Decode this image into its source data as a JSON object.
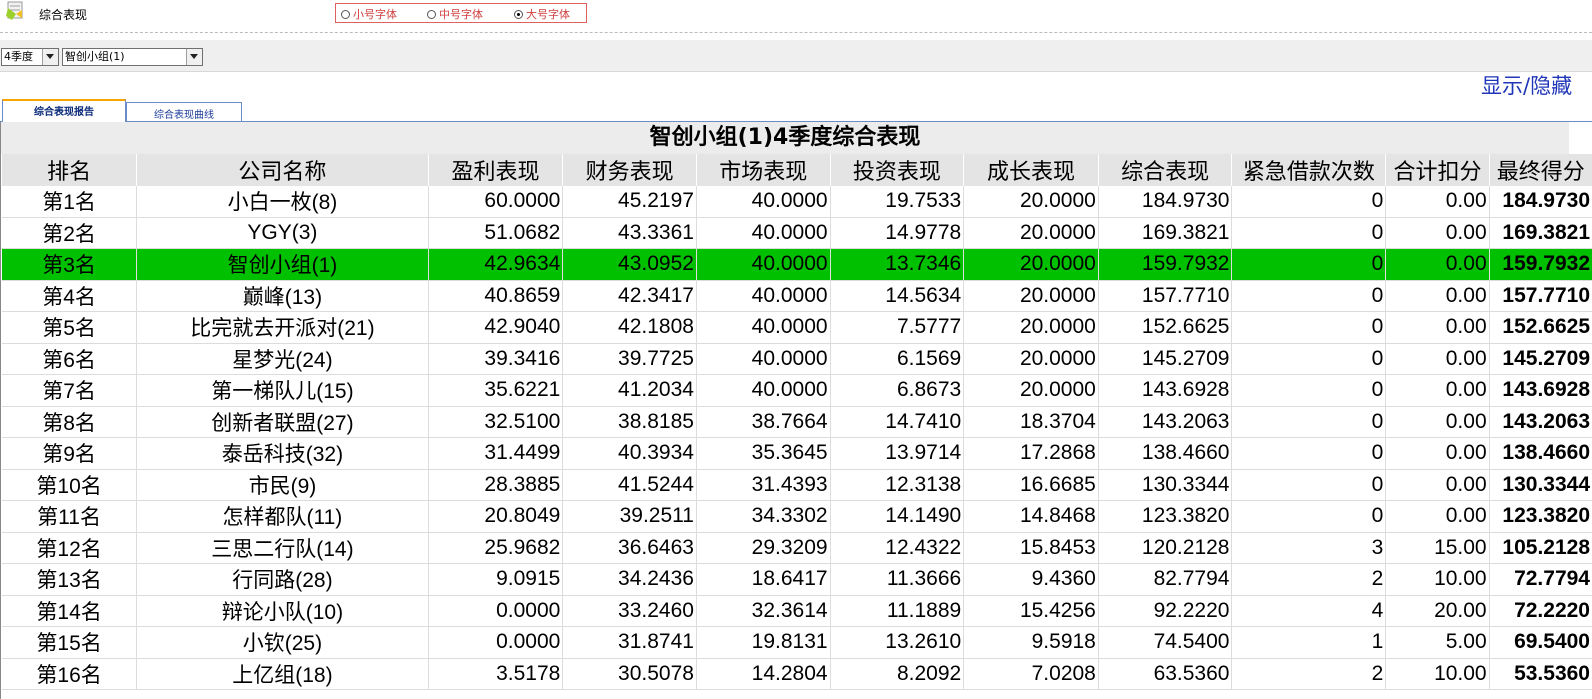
{
  "header": {
    "page_title": "综合表现",
    "font_size_options": [
      {
        "label": "小号字体",
        "checked": false
      },
      {
        "label": "中号字体",
        "checked": false
      },
      {
        "label": "大号字体",
        "checked": true
      }
    ]
  },
  "filters": {
    "quarter": "4季度",
    "group": "智创小组(1)"
  },
  "toggle_label": "显示/隐藏",
  "tabs": [
    {
      "label": "综合表现报告",
      "active": true
    },
    {
      "label": "综合表现曲线",
      "active": false
    }
  ],
  "report": {
    "title": "智创小组(1)4季度综合表现",
    "columns": [
      "排名",
      "公司名称",
      "盈利表现",
      "财务表现",
      "市场表现",
      "投资表现",
      "成长表现",
      "综合表现",
      "紧急借款次数",
      "合计扣分",
      "最终得分"
    ],
    "highlight_color": "#00c000",
    "rows": [
      {
        "rank": "第1名",
        "company": "小白一枚(8)",
        "profit": "60.0000",
        "finance": "45.2197",
        "market": "40.0000",
        "invest": "19.7533",
        "growth": "20.0000",
        "overall": "184.9730",
        "loans": "0",
        "deduct": "0.00",
        "final": "184.9730",
        "highlight": false
      },
      {
        "rank": "第2名",
        "company": "YGY(3)",
        "profit": "51.0682",
        "finance": "43.3361",
        "market": "40.0000",
        "invest": "14.9778",
        "growth": "20.0000",
        "overall": "169.3821",
        "loans": "0",
        "deduct": "0.00",
        "final": "169.3821",
        "highlight": false
      },
      {
        "rank": "第3名",
        "company": "智创小组(1)",
        "profit": "42.9634",
        "finance": "43.0952",
        "market": "40.0000",
        "invest": "13.7346",
        "growth": "20.0000",
        "overall": "159.7932",
        "loans": "0",
        "deduct": "0.00",
        "final": "159.7932",
        "highlight": true
      },
      {
        "rank": "第4名",
        "company": "巅峰(13)",
        "profit": "40.8659",
        "finance": "42.3417",
        "market": "40.0000",
        "invest": "14.5634",
        "growth": "20.0000",
        "overall": "157.7710",
        "loans": "0",
        "deduct": "0.00",
        "final": "157.7710",
        "highlight": false
      },
      {
        "rank": "第5名",
        "company": "比完就去开派对(21)",
        "profit": "42.9040",
        "finance": "42.1808",
        "market": "40.0000",
        "invest": "7.5777",
        "growth": "20.0000",
        "overall": "152.6625",
        "loans": "0",
        "deduct": "0.00",
        "final": "152.6625",
        "highlight": false
      },
      {
        "rank": "第6名",
        "company": "星梦光(24)",
        "profit": "39.3416",
        "finance": "39.7725",
        "market": "40.0000",
        "invest": "6.1569",
        "growth": "20.0000",
        "overall": "145.2709",
        "loans": "0",
        "deduct": "0.00",
        "final": "145.2709",
        "highlight": false
      },
      {
        "rank": "第7名",
        "company": "第一梯队儿(15)",
        "profit": "35.6221",
        "finance": "41.2034",
        "market": "40.0000",
        "invest": "6.8673",
        "growth": "20.0000",
        "overall": "143.6928",
        "loans": "0",
        "deduct": "0.00",
        "final": "143.6928",
        "highlight": false
      },
      {
        "rank": "第8名",
        "company": "创新者联盟(27)",
        "profit": "32.5100",
        "finance": "38.8185",
        "market": "38.7664",
        "invest": "14.7410",
        "growth": "18.3704",
        "overall": "143.2063",
        "loans": "0",
        "deduct": "0.00",
        "final": "143.2063",
        "highlight": false
      },
      {
        "rank": "第9名",
        "company": "泰岳科技(32)",
        "profit": "31.4499",
        "finance": "40.3934",
        "market": "35.3645",
        "invest": "13.9714",
        "growth": "17.2868",
        "overall": "138.4660",
        "loans": "0",
        "deduct": "0.00",
        "final": "138.4660",
        "highlight": false
      },
      {
        "rank": "第10名",
        "company": "市民(9)",
        "profit": "28.3885",
        "finance": "41.5244",
        "market": "31.4393",
        "invest": "12.3138",
        "growth": "16.6685",
        "overall": "130.3344",
        "loans": "0",
        "deduct": "0.00",
        "final": "130.3344",
        "highlight": false
      },
      {
        "rank": "第11名",
        "company": "怎样都队(11)",
        "profit": "20.8049",
        "finance": "39.2511",
        "market": "34.3302",
        "invest": "14.1490",
        "growth": "14.8468",
        "overall": "123.3820",
        "loans": "0",
        "deduct": "0.00",
        "final": "123.3820",
        "highlight": false
      },
      {
        "rank": "第12名",
        "company": "三思二行队(14)",
        "profit": "25.9682",
        "finance": "36.6463",
        "market": "29.3209",
        "invest": "12.4322",
        "growth": "15.8453",
        "overall": "120.2128",
        "loans": "3",
        "deduct": "15.00",
        "final": "105.2128",
        "highlight": false
      },
      {
        "rank": "第13名",
        "company": "行同路(28)",
        "profit": "9.0915",
        "finance": "34.2436",
        "market": "18.6417",
        "invest": "11.3666",
        "growth": "9.4360",
        "overall": "82.7794",
        "loans": "2",
        "deduct": "10.00",
        "final": "72.7794",
        "highlight": false
      },
      {
        "rank": "第14名",
        "company": "辩论小队(10)",
        "profit": "0.0000",
        "finance": "33.2460",
        "market": "32.3614",
        "invest": "11.1889",
        "growth": "15.4256",
        "overall": "92.2220",
        "loans": "4",
        "deduct": "20.00",
        "final": "72.2220",
        "highlight": false
      },
      {
        "rank": "第15名",
        "company": "小钦(25)",
        "profit": "0.0000",
        "finance": "31.8741",
        "market": "19.8131",
        "invest": "13.2610",
        "growth": "9.5918",
        "overall": "74.5400",
        "loans": "1",
        "deduct": "5.00",
        "final": "69.5400",
        "highlight": false
      },
      {
        "rank": "第16名",
        "company": "上亿组(18)",
        "profit": "3.5178",
        "finance": "30.5078",
        "market": "14.2804",
        "invest": "8.2092",
        "growth": "7.0208",
        "overall": "63.5360",
        "loans": "2",
        "deduct": "10.00",
        "final": "53.5360",
        "highlight": false
      }
    ]
  }
}
